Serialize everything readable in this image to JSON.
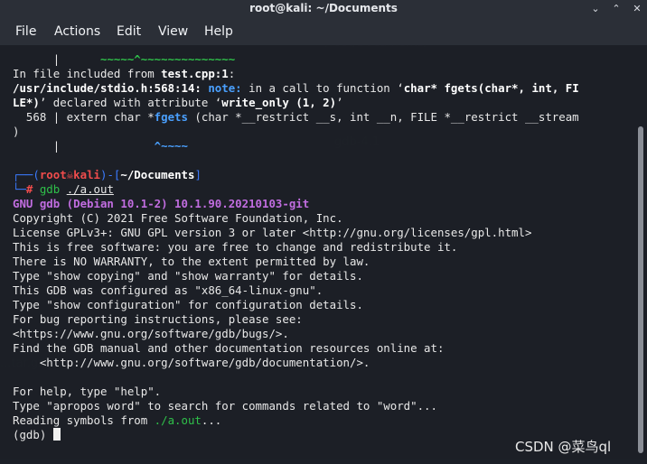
{
  "window": {
    "title": "root@kali: ~/Documents"
  },
  "menu": [
    "File",
    "Actions",
    "Edit",
    "View",
    "Help"
  ],
  "lines": {
    "l0_tilde": "~~~~~^~~~~~~~~~~~~~~",
    "l1a": "In file included from ",
    "l1b": "test.cpp:1",
    "l1c": ":",
    "l2a": "/usr/include/stdio.h:568:14: ",
    "l2b": "note:",
    "l2c": " in a call to function ‘",
    "l2d": "char* fgets(char*, int, FI",
    "l3a": "LE*)",
    "l3b": "’ declared with attribute ‘",
    "l3c": "write_only (1, 2)",
    "l3d": "’",
    "l4a": "  568 | extern char *",
    "l4b": "fgets",
    "l4c": " (char *__restrict __s, int __n, FILE *__restrict __stream",
    "l5": ")",
    "l6bar": "      |",
    "l6tilde": "^~~~~",
    "p_top_a": "┌──(",
    "p_root": "root",
    "p_skull": "☠",
    "p_kali": "kali",
    "p_mid": ")-[",
    "p_dir": "~/Documents",
    "p_end": "]",
    "p_bot_a": "└─",
    "p_hash": "#",
    "p_cmd": " gdb ",
    "p_arg": "./a.out",
    "gdb1": "GNU gdb (Debian 10.1-2) 10.1.90.20210103-git",
    "gdb2": "Copyright (C) 2021 Free Software Foundation, Inc.",
    "gdb3": "License GPLv3+: GNU GPL version 3 or later <http://gnu.org/licenses/gpl.html>",
    "gdb4": "This is free software: you are free to change and redistribute it.",
    "gdb5": "There is NO WARRANTY, to the extent permitted by law.",
    "gdb6": "Type \"show copying\" and \"show warranty\" for details.",
    "gdb7": "This GDB was configured as \"x86_64-linux-gnu\".",
    "gdb8": "Type \"show configuration\" for configuration details.",
    "gdb9": "For bug reporting instructions, please see:",
    "gdb10": "<https://www.gnu.org/software/gdb/bugs/>.",
    "gdb11": "Find the GDB manual and other documentation resources online at:",
    "gdb12": "    <http://www.gnu.org/software/gdb/documentation/>.",
    "gdb13": "For help, type \"help\".",
    "gdb14": "Type \"apropos word\" to search for commands related to \"word\"...",
    "gdb15a": "Reading symbols from ",
    "gdb15b": "./a.out",
    "gdb15c": "...",
    "gdb16": "(gdb) "
  },
  "watermark": "CSDN @菜鸟ql",
  "icons": [
    "minimize-icon",
    "maximize-icon",
    "close-icon"
  ],
  "colors": {
    "prompt": "#3b7bff",
    "root": "#f14c4c",
    "note": "#4aa0ff",
    "gdb_banner": "#c16de0"
  }
}
